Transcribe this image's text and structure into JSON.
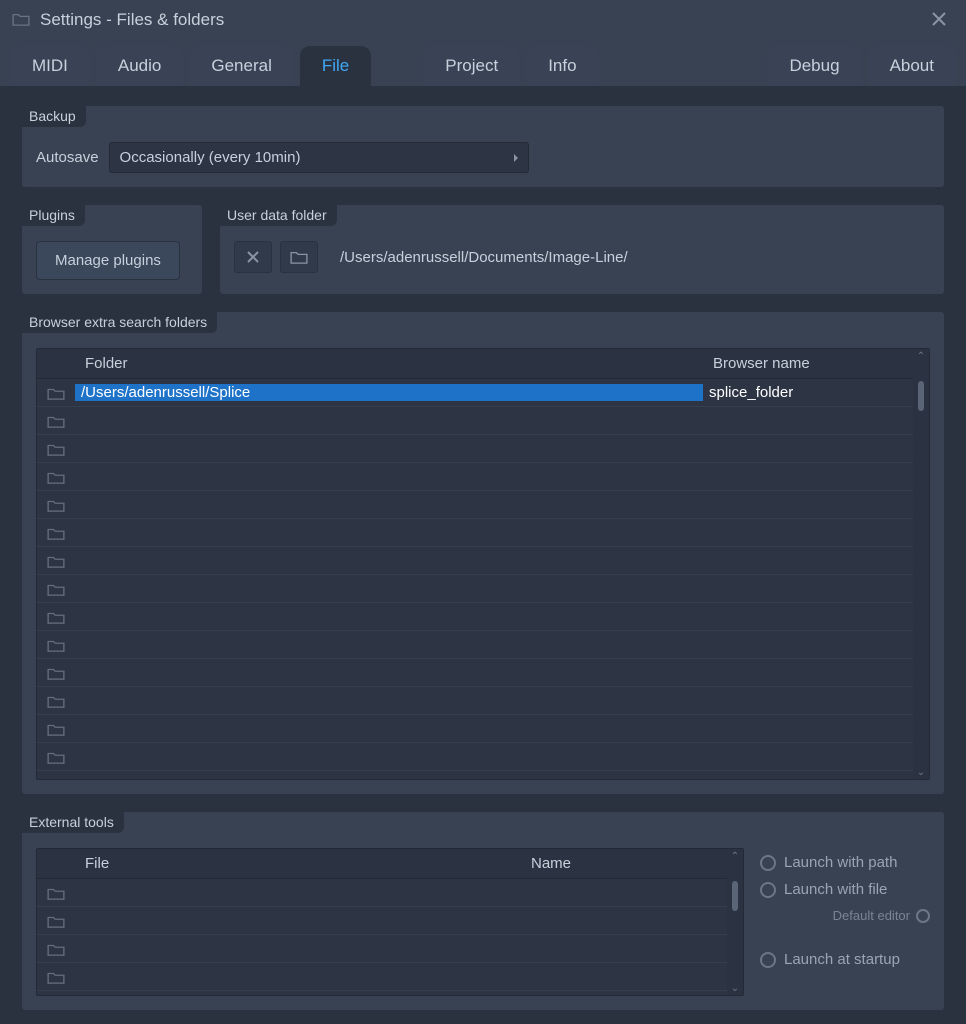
{
  "title": "Settings - Files & folders",
  "tabs": [
    "MIDI",
    "Audio",
    "General",
    "File",
    "Project",
    "Info",
    "Debug",
    "About"
  ],
  "active_tab": "File",
  "backup": {
    "panel_label": "Backup",
    "autosave_label": "Autosave",
    "autosave_value": "Occasionally (every 10min)"
  },
  "plugins": {
    "panel_label": "Plugins",
    "manage_button": "Manage plugins"
  },
  "userdata": {
    "panel_label": "User data folder",
    "path": "/Users/adenrussell/Documents/Image-Line/"
  },
  "browser_folders": {
    "panel_label": "Browser extra search folders",
    "col_folder": "Folder",
    "col_name": "Browser name",
    "rows": [
      {
        "path": "/Users/adenrussell/Splice",
        "name": "splice_folder",
        "selected": true
      },
      {
        "path": "",
        "name": ""
      },
      {
        "path": "",
        "name": ""
      },
      {
        "path": "",
        "name": ""
      },
      {
        "path": "",
        "name": ""
      },
      {
        "path": "",
        "name": ""
      },
      {
        "path": "",
        "name": ""
      },
      {
        "path": "",
        "name": ""
      },
      {
        "path": "",
        "name": ""
      },
      {
        "path": "",
        "name": ""
      },
      {
        "path": "",
        "name": ""
      },
      {
        "path": "",
        "name": ""
      },
      {
        "path": "",
        "name": ""
      },
      {
        "path": "",
        "name": ""
      }
    ]
  },
  "external_tools": {
    "panel_label": "External tools",
    "col_file": "File",
    "col_name": "Name",
    "rows": [
      {
        "file": "",
        "name": "",
        "selected": true
      },
      {
        "file": "",
        "name": ""
      },
      {
        "file": "",
        "name": ""
      },
      {
        "file": "",
        "name": ""
      }
    ],
    "opt_launch_path": "Launch with path",
    "opt_launch_file": "Launch with file",
    "opt_default_editor": "Default editor",
    "opt_launch_startup": "Launch at startup"
  }
}
